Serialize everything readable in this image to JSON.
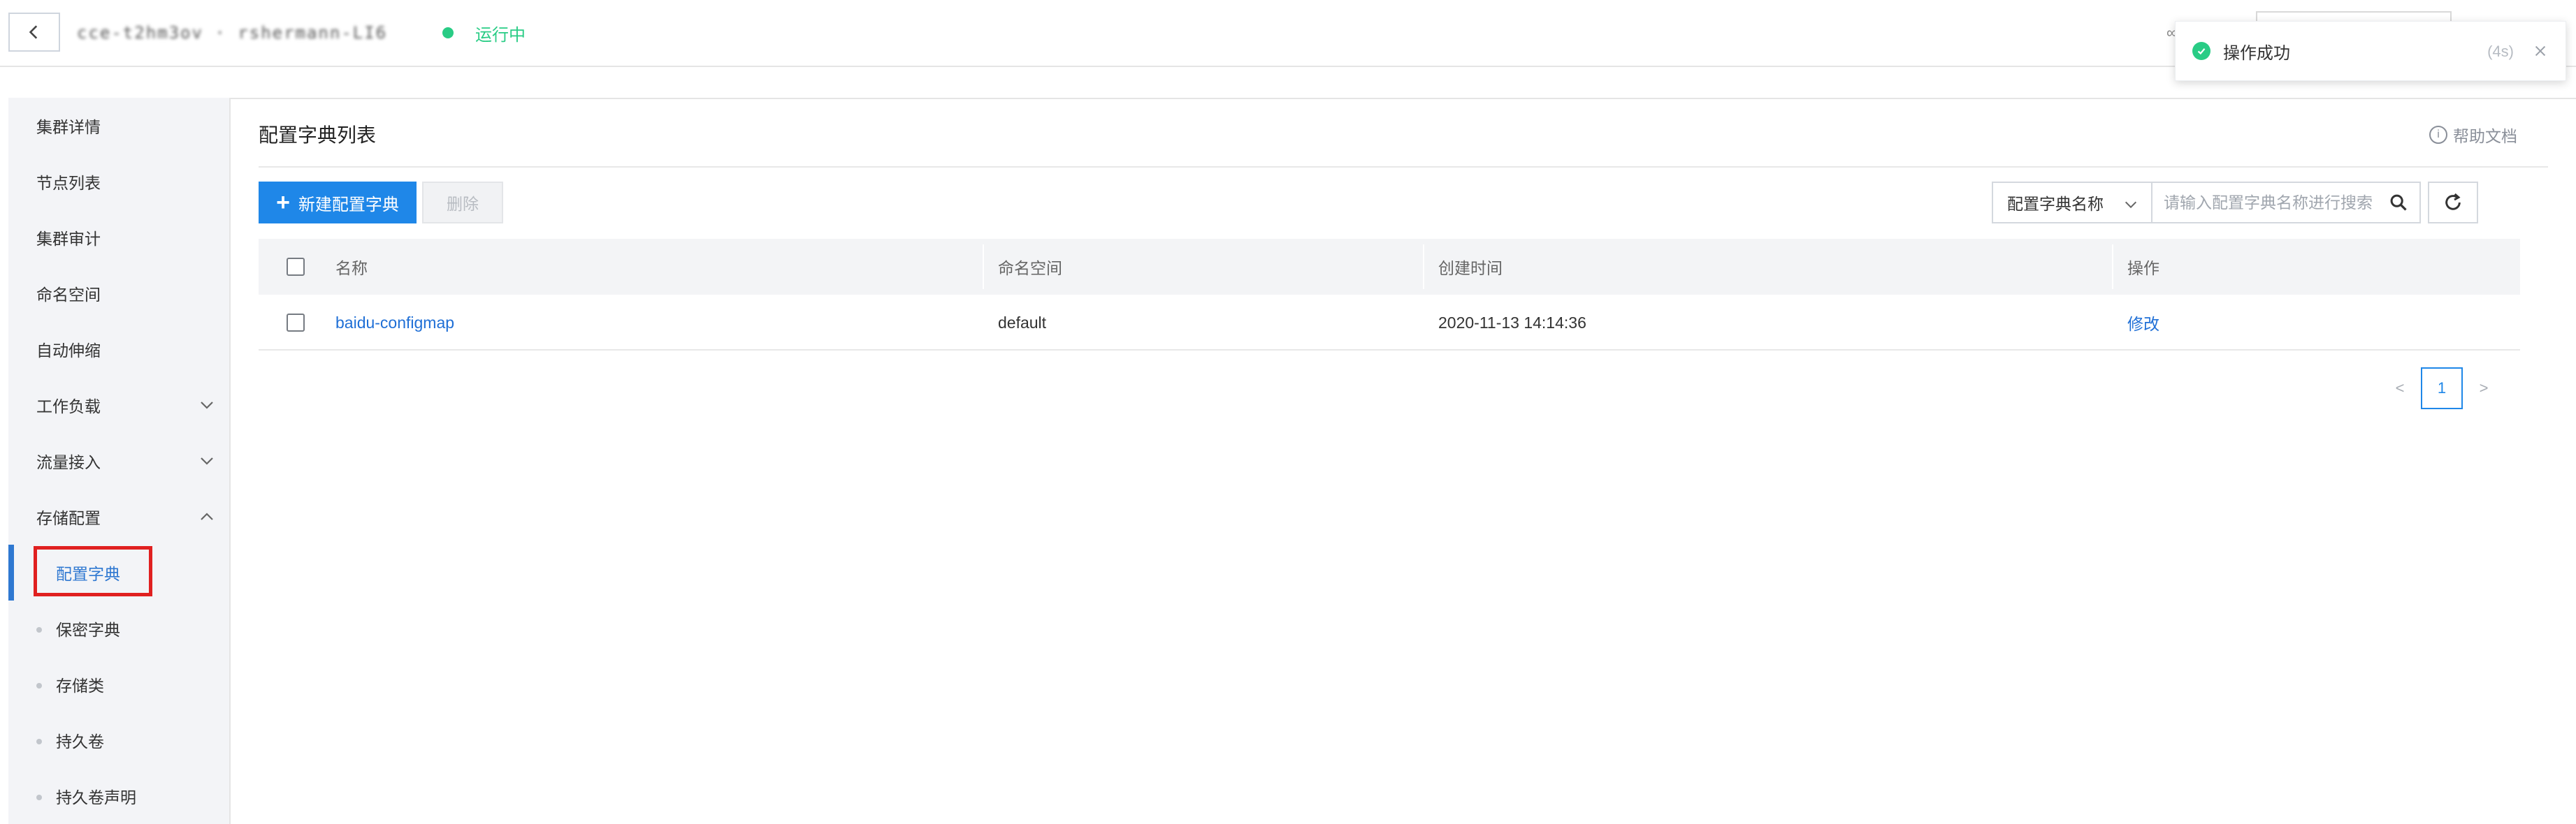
{
  "header": {
    "cluster_name": "cce-t2hm3ov · rshermann-LI6",
    "status": "运行中",
    "right_fragment": "∞"
  },
  "toast": {
    "message": "操作成功",
    "timer": "(4s)"
  },
  "sidebar": {
    "items": [
      {
        "label": "集群详情"
      },
      {
        "label": "节点列表"
      },
      {
        "label": "集群审计"
      },
      {
        "label": "命名空间"
      },
      {
        "label": "自动伸缩"
      },
      {
        "label": "工作负载",
        "expandable": true,
        "expanded": false
      },
      {
        "label": "流量接入",
        "expandable": true,
        "expanded": false
      },
      {
        "label": "存储配置",
        "expandable": true,
        "expanded": true
      }
    ],
    "sub_items": [
      {
        "label": "配置字典",
        "active": true
      },
      {
        "label": "保密字典"
      },
      {
        "label": "存储类"
      },
      {
        "label": "持久卷"
      },
      {
        "label": "持久卷声明"
      }
    ]
  },
  "main": {
    "title": "配置字典列表",
    "help_label": "帮助文档",
    "toolbar": {
      "create_label": "新建配置字典",
      "delete_label": "删除",
      "search_field_label": "配置字典名称",
      "search_placeholder": "请输入配置字典名称进行搜索"
    },
    "table": {
      "columns": [
        "名称",
        "命名空间",
        "创建时间",
        "操作"
      ],
      "rows": [
        {
          "name": "baidu-configmap",
          "namespace": "default",
          "created": "2020-11-13 14:14:36",
          "action": "修改"
        }
      ]
    },
    "pagination": {
      "prev": "<",
      "current": "1",
      "next": ">"
    }
  },
  "colors": {
    "primary": "#1f87e8",
    "success": "#29cc85",
    "highlight": "#e02020",
    "sidebar_bg": "#f3f4f7"
  }
}
